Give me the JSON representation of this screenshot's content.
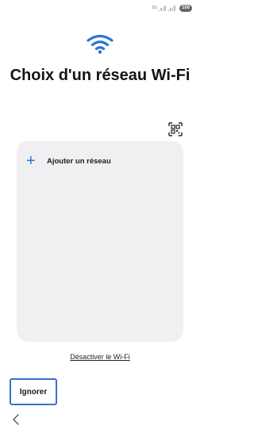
{
  "status_bar": {
    "network_label": "5G",
    "battery": "100",
    "icons": [
      "signal-icon",
      "battery-icon"
    ]
  },
  "header": {
    "logo_icon": "wifi-icon",
    "title": "Choix d'un réseau Wi-Fi"
  },
  "toolbar": {
    "qr_icon": "qr-scan-icon"
  },
  "network_list": {
    "add_icon": "plus-icon",
    "add_label": "Ajouter un réseau"
  },
  "footer": {
    "disable_link": "Désactiver le Wi-Fi",
    "skip_label": "Ignorer",
    "back_icon": "back-chevron-icon"
  },
  "colors": {
    "accent": "#2a73d9",
    "card_bg": "#f0f0f3",
    "focus_outline": "#3a6fcc"
  }
}
